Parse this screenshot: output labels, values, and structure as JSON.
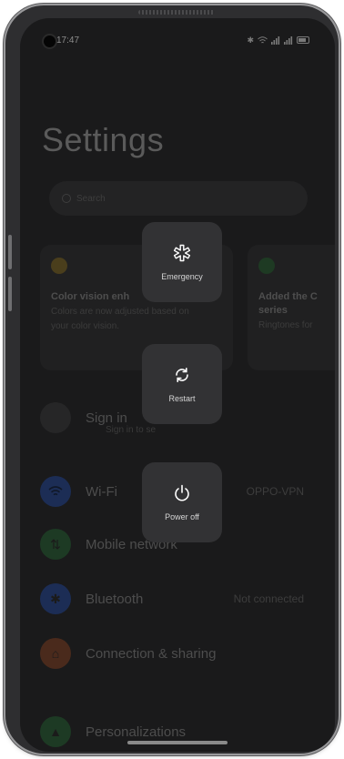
{
  "status_bar": {
    "time": "17:47"
  },
  "settings": {
    "title": "Settings",
    "search_placeholder": "Search",
    "cards": [
      {
        "title": "Color vision enh",
        "subtitle_line1": "Colors are now adjusted based on",
        "subtitle_line2": "your color vision.",
        "dot_color": "#4a3e1c"
      },
      {
        "title": "Added the C",
        "title_line2": "series",
        "subtitle_line1": "Ringtones for",
        "dot_color": "#1e3a23"
      }
    ],
    "sign_in": {
      "label": "Sign in",
      "subtitle": "Sign in to se"
    },
    "rows": [
      {
        "label": "Wi-Fi",
        "value": "OPPO-VPN",
        "icon": "wifi-icon",
        "color": "#1c2d55"
      },
      {
        "label": "Mobile network",
        "value": "",
        "icon": "mobile-network-icon",
        "color": "#1d3a24"
      },
      {
        "label": "Bluetooth",
        "value": "Not connected",
        "icon": "bluetooth-icon",
        "color": "#1c2d55"
      },
      {
        "label": "Connection & sharing",
        "value": "",
        "icon": "connection-sharing-icon",
        "color": "#4a2a1c"
      },
      {
        "label": "Personalizations",
        "value": "",
        "icon": "personalizations-icon",
        "color": "#1d3a24"
      }
    ]
  },
  "power_menu": {
    "emergency": "Emergency",
    "restart": "Restart",
    "power_off": "Power off"
  }
}
